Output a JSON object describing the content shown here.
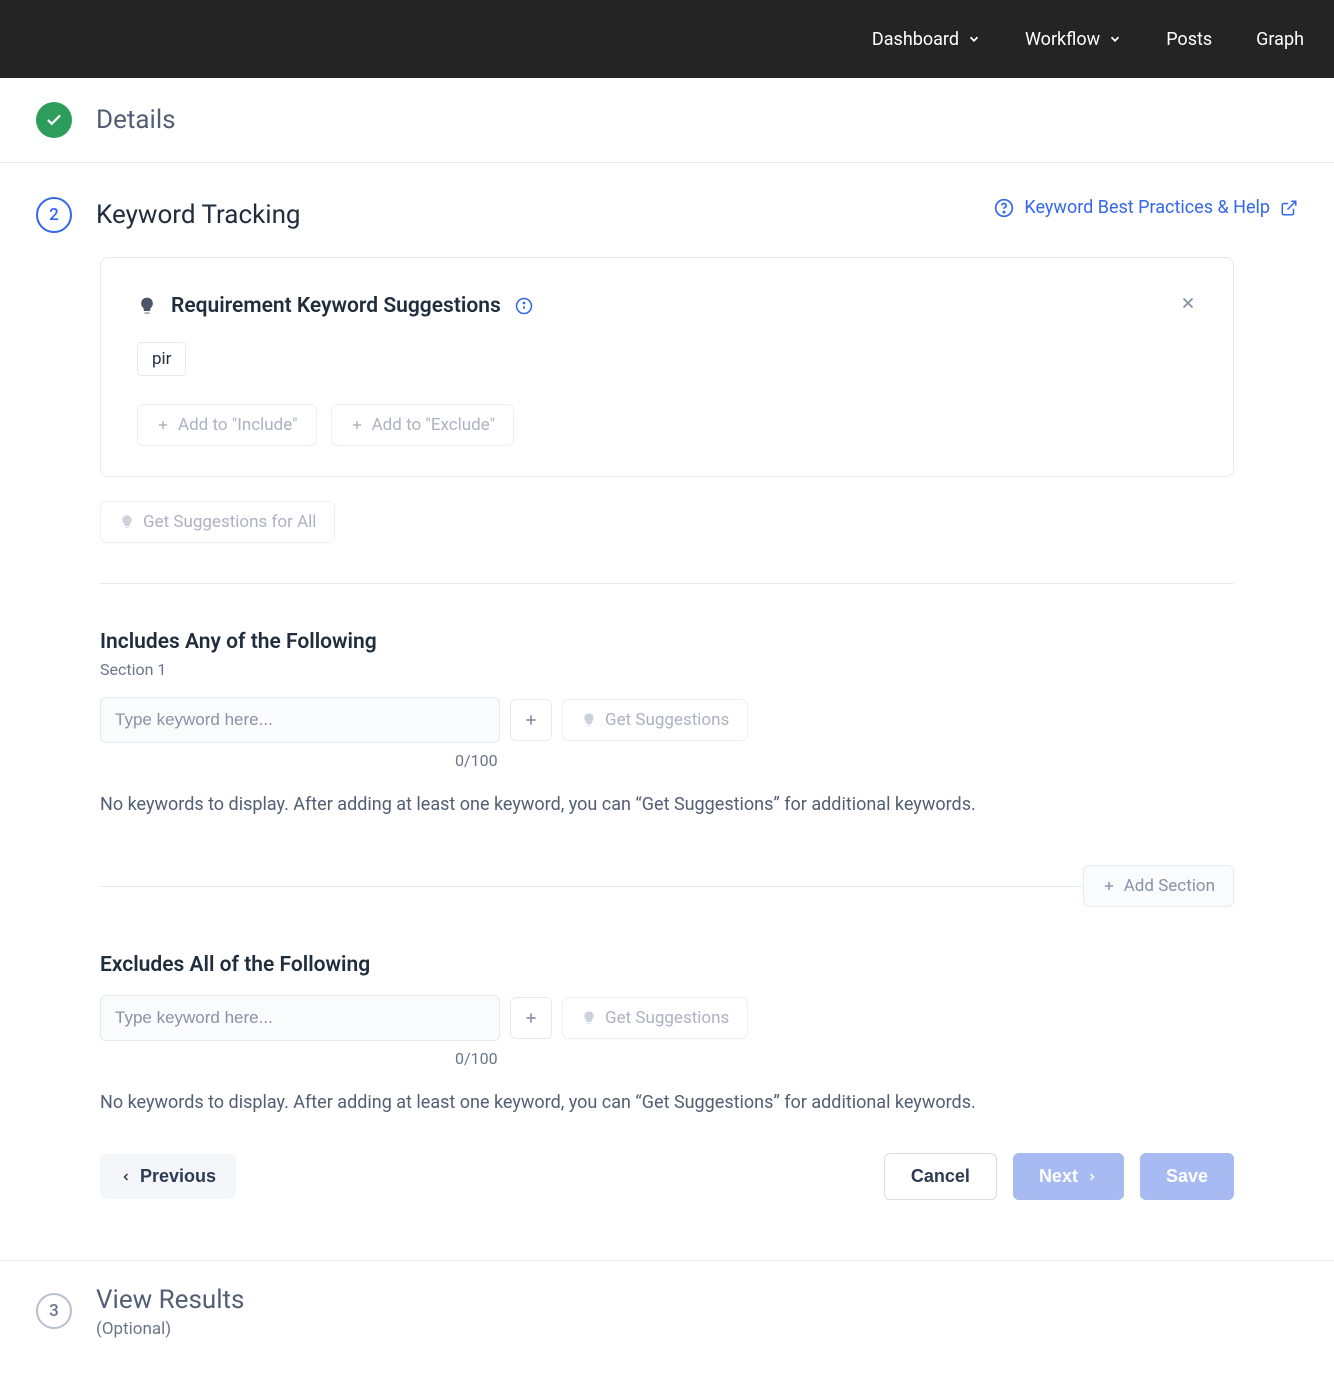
{
  "nav": {
    "dashboard": "Dashboard",
    "workflow": "Workflow",
    "posts": "Posts",
    "graph": "Graph"
  },
  "step1": {
    "title": "Details"
  },
  "step2": {
    "number": "2",
    "title": "Keyword Tracking",
    "help_link": "Keyword Best Practices & Help"
  },
  "suggestions": {
    "title": "Requirement Keyword Suggestions",
    "chip": "pir",
    "add_include": "Add to \"Include\"",
    "add_exclude": "Add to \"Exclude\"",
    "get_all": "Get Suggestions for All"
  },
  "includes": {
    "title": "Includes Any of the Following",
    "section_label": "Section 1",
    "placeholder": "Type keyword here...",
    "counter": "0/100",
    "get_suggestions": "Get Suggestions",
    "empty": "No keywords to display. After adding at least one keyword, you can “Get Suggestions” for additional keywords.",
    "add_section": "Add Section"
  },
  "excludes": {
    "title": "Excludes All of the Following",
    "placeholder": "Type keyword here...",
    "counter": "0/100",
    "get_suggestions": "Get Suggestions",
    "empty": "No keywords to display. After adding at least one keyword, you can “Get Suggestions” for additional keywords."
  },
  "footer": {
    "previous": "Previous",
    "cancel": "Cancel",
    "next": "Next",
    "save": "Save"
  },
  "step3": {
    "number": "3",
    "title": "View Results",
    "subtitle": "(Optional)"
  }
}
